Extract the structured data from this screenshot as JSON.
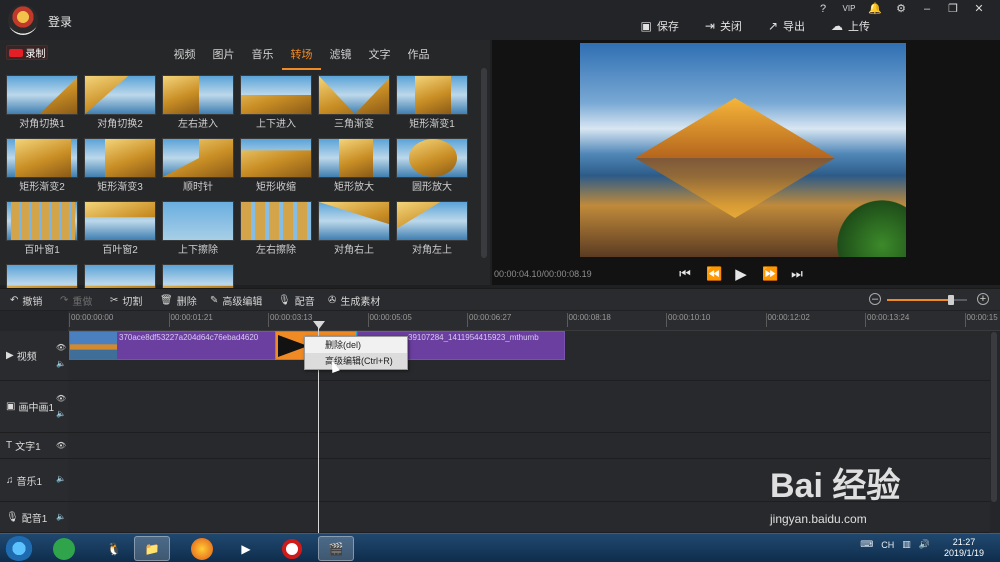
{
  "topbar": {
    "login": "登录",
    "window_icons": [
      "?",
      "VIP",
      "🔔",
      "⚙",
      "–",
      "❐",
      "✕"
    ],
    "actions": [
      {
        "icon": "save-icon",
        "label": "保存"
      },
      {
        "icon": "close-doc-icon",
        "label": "关闭"
      },
      {
        "icon": "export-icon",
        "label": "导出"
      },
      {
        "icon": "upload-icon",
        "label": "上传"
      }
    ]
  },
  "left": {
    "record": "录制",
    "tabs": [
      "视频",
      "图片",
      "音乐",
      "转场",
      "滤镜",
      "文字",
      "作品"
    ],
    "active_tab": "转场",
    "transitions": [
      "对角切换1",
      "对角切换2",
      "左右进入",
      "上下进入",
      "三角渐变",
      "矩形渐变1",
      "矩形渐变2",
      "矩形渐变3",
      "顺时针",
      "矩形收缩",
      "矩形放大",
      "圆形放大",
      "百叶窗1",
      "百叶窗2",
      "上下擦除",
      "左右擦除",
      "对角右上",
      "对角左上",
      "",
      "",
      ""
    ]
  },
  "preview": {
    "time": "00:00:04.10/00:00:08.19",
    "controls": [
      "skip-start-icon",
      "prev-frame-icon",
      "play-icon",
      "next-frame-icon",
      "skip-end-icon"
    ]
  },
  "toolbar": {
    "undo": "撤销",
    "redo": "重做",
    "cut": "切割",
    "delete": "删除",
    "advanced_edit": "高级编辑",
    "dub": "配音",
    "generate": "生成素材",
    "zoom_level": 0.8
  },
  "timeline": {
    "ruler": [
      "00:00:00:00",
      "00:00:01:21",
      "00:00:03:13",
      "00:00:05:05",
      "00:00:06:27",
      "00:00:08:18",
      "00:00:10:10",
      "00:00:12:02",
      "00:00:13:24",
      "00:00:15"
    ],
    "tracks": [
      {
        "name": "视频",
        "icon": "▶"
      },
      {
        "name": "画中画1",
        "icon": "▣"
      },
      {
        "name": "文字1",
        "icon": "T"
      },
      {
        "name": "音乐1",
        "icon": "♫"
      },
      {
        "name": "配音1",
        "icon": "🎙"
      }
    ],
    "clip1_label": "370ace8df53227a204d64c76ebad4620",
    "clip2_label": "39107284_1411954415923_mthumb"
  },
  "context_menu": {
    "items": [
      "删除(del)",
      "高级编辑(Ctrl+R)"
    ]
  },
  "taskbar": {
    "time": "21:27",
    "date": "2019/1/19",
    "lang": "CH"
  },
  "watermark": {
    "text": "Bai 经验",
    "url": "jingyan.baidu.com"
  },
  "colors": {
    "accent": "#f08a24",
    "clip": "#6b3fa0",
    "record": "#e21f26"
  }
}
